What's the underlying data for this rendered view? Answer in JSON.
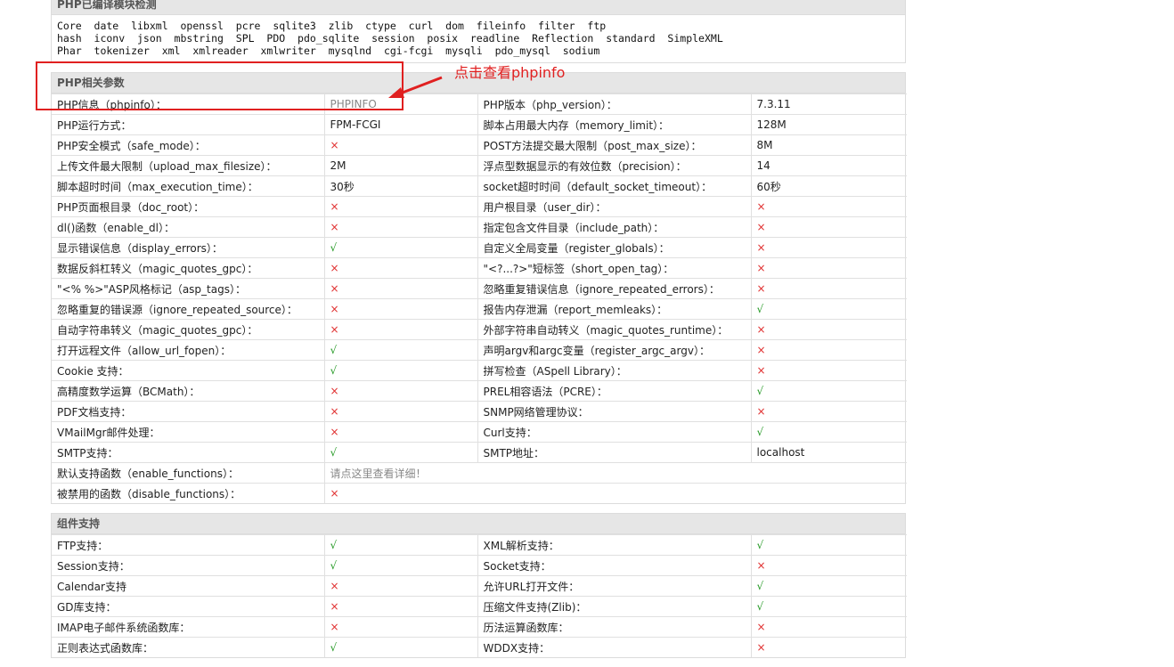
{
  "compiled_section": {
    "title": "PHP已编译模块检测",
    "lines": [
      "Core  date  libxml  openssl  pcre  sqlite3  zlib  ctype  curl  dom  fileinfo  filter  ftp",
      "hash  iconv  json  mbstring  SPL  PDO  pdo_sqlite  session  posix  readline  Reflection  standard  SimpleXML",
      "Phar  tokenizer  xml  xmlreader  xmlwriter  mysqlnd  cgi-fcgi  mysqli  pdo_mysql  sodium"
    ]
  },
  "params_section": {
    "title": "PHP相关参数",
    "rows": [
      {
        "l1": "PHP信息（phpinfo）：",
        "v1": "PHPINFO",
        "l2": "PHP版本（php_version）：",
        "v2": "7.3.11"
      },
      {
        "l1": "PHP运行方式：",
        "v1": "FPM-FCGI",
        "l2": "脚本占用最大内存（memory_limit）：",
        "v2": "128M"
      },
      {
        "l1": "PHP安全模式（safe_mode）：",
        "v1": "×",
        "l2": "POST方法提交最大限制（post_max_size）：",
        "v2": "8M"
      },
      {
        "l1": "上传文件最大限制（upload_max_filesize）：",
        "v1": "2M",
        "l2": "浮点型数据显示的有效位数（precision）：",
        "v2": "14"
      },
      {
        "l1": "脚本超时时间（max_execution_time）：",
        "v1": "30秒",
        "l2": "socket超时时间（default_socket_timeout）：",
        "v2": "60秒"
      },
      {
        "l1": "PHP页面根目录（doc_root）：",
        "v1": "×",
        "l2": "用户根目录（user_dir）：",
        "v2": "×"
      },
      {
        "l1": "dl()函数（enable_dl）：",
        "v1": "×",
        "l2": "指定包含文件目录（include_path）：",
        "v2": "×"
      },
      {
        "l1": "显示错误信息（display_errors）：",
        "v1": "√",
        "l2": "自定义全局变量（register_globals）：",
        "v2": "×"
      },
      {
        "l1": "数据反斜杠转义（magic_quotes_gpc）：",
        "v1": "×",
        "l2": "\"<?...?>\"短标签（short_open_tag）：",
        "v2": "×"
      },
      {
        "l1": "\"<% %>\"ASP风格标记（asp_tags）：",
        "v1": "×",
        "l2": "忽略重复错误信息（ignore_repeated_errors）：",
        "v2": "×"
      },
      {
        "l1": "忽略重复的错误源（ignore_repeated_source）：",
        "v1": "×",
        "l2": "报告内存泄漏（report_memleaks）：",
        "v2": "√"
      },
      {
        "l1": "自动字符串转义（magic_quotes_gpc）：",
        "v1": "×",
        "l2": "外部字符串自动转义（magic_quotes_runtime）：",
        "v2": "×"
      },
      {
        "l1": "打开远程文件（allow_url_fopen）：",
        "v1": "√",
        "l2": "声明argv和argc变量（register_argc_argv）：",
        "v2": "×"
      },
      {
        "l1": "Cookie 支持：",
        "v1": "√",
        "l2": "拼写检查（ASpell Library）：",
        "v2": "×"
      },
      {
        "l1": "高精度数学运算（BCMath）：",
        "v1": "×",
        "l2": "PREL相容语法（PCRE）：",
        "v2": "√"
      },
      {
        "l1": "PDF文档支持：",
        "v1": "×",
        "l2": "SNMP网络管理协议：",
        "v2": "×"
      },
      {
        "l1": "VMailMgr邮件处理：",
        "v1": "×",
        "l2": "Curl支持：",
        "v2": "√"
      },
      {
        "l1": "SMTP支持：",
        "v1": "√",
        "l2": "SMTP地址：",
        "v2": "localhost"
      }
    ],
    "wide_rows": [
      {
        "l1": "默认支持函数（enable_functions）：",
        "v1": "请点这里查看详细！"
      },
      {
        "l1": "被禁用的函数（disable_functions）：",
        "v1": "×"
      }
    ]
  },
  "components_section": {
    "title": "组件支持",
    "rows": [
      {
        "l1": "FTP支持：",
        "v1": "√",
        "l2": "XML解析支持：",
        "v2": "√"
      },
      {
        "l1": "Session支持：",
        "v1": "√",
        "l2": "Socket支持：",
        "v2": "×"
      },
      {
        "l1": "Calendar支持",
        "v1": "×",
        "l2": "允许URL打开文件：",
        "v2": "√"
      },
      {
        "l1": "GD库支持：",
        "v1": "×",
        "l2": "压缩文件支持(Zlib)：",
        "v2": "√"
      },
      {
        "l1": "IMAP电子邮件系统函数库：",
        "v1": "×",
        "l2": "历法运算函数库：",
        "v2": "×"
      },
      {
        "l1": "正则表达式函数库：",
        "v1": "√",
        "l2": "WDDX支持：",
        "v2": "×"
      }
    ]
  },
  "annotation": {
    "text": "点击查看phpinfo",
    "color": "#e02020"
  }
}
